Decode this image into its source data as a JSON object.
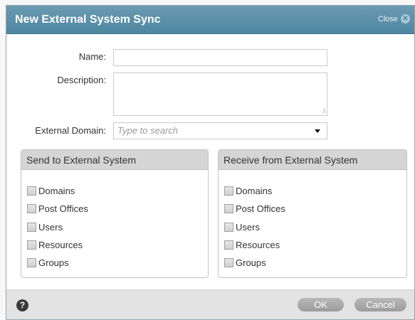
{
  "dialog": {
    "title": "New External System Sync",
    "close_label": "Close",
    "close_icon": "close-icon"
  },
  "form": {
    "name_label": "Name:",
    "name_value": "",
    "description_label": "Description:",
    "description_value": "",
    "external_domain_label": "External Domain:",
    "external_domain_placeholder": "Type to search"
  },
  "send_group": {
    "title": "Send to External System",
    "items": [
      {
        "label": "Domains",
        "checked": false
      },
      {
        "label": "Post Offices",
        "checked": false
      },
      {
        "label": "Users",
        "checked": false
      },
      {
        "label": "Resources",
        "checked": false
      },
      {
        "label": "Groups",
        "checked": false
      }
    ]
  },
  "receive_group": {
    "title": "Receive from External System",
    "items": [
      {
        "label": "Domains",
        "checked": false
      },
      {
        "label": "Post Offices",
        "checked": false
      },
      {
        "label": "Users",
        "checked": false
      },
      {
        "label": "Resources",
        "checked": false
      },
      {
        "label": "Groups",
        "checked": false
      }
    ]
  },
  "footer": {
    "help_icon": "help-icon",
    "help_glyph": "?",
    "ok_label": "OK",
    "cancel_label": "Cancel"
  },
  "colors": {
    "titlebar": "#4f86a0",
    "group_header": "#d5d5d5",
    "footer": "#e3e3e3",
    "button": "#a8a8a8"
  }
}
